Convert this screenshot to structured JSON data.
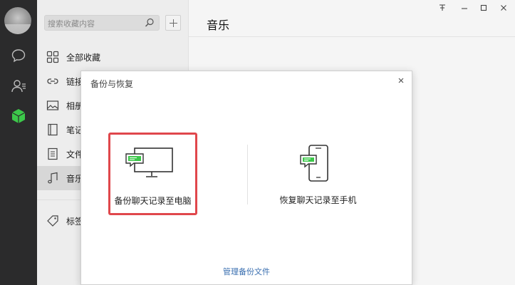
{
  "sidebar": {
    "search_placeholder": "搜索收藏内容",
    "items": [
      {
        "label": "全部收藏",
        "icon": "grid-icon"
      },
      {
        "label": "链接",
        "icon": "link-icon"
      },
      {
        "label": "相册",
        "icon": "image-icon"
      },
      {
        "label": "笔记",
        "icon": "notebook-icon"
      },
      {
        "label": "文件",
        "icon": "file-icon"
      },
      {
        "label": "音乐",
        "icon": "music-icon"
      },
      {
        "label": "标签",
        "icon": "tag-icon"
      }
    ]
  },
  "main": {
    "title": "音乐"
  },
  "dialog": {
    "title": "备份与恢复",
    "backup_to_pc": "备份聊天记录至电脑",
    "restore_to_phone": "恢复聊天记录至手机",
    "manage_link": "管理备份文件"
  },
  "colors": {
    "accent_green": "#3cc84a",
    "highlight_red": "#e0474c",
    "link_blue": "#3a6fb0"
  }
}
